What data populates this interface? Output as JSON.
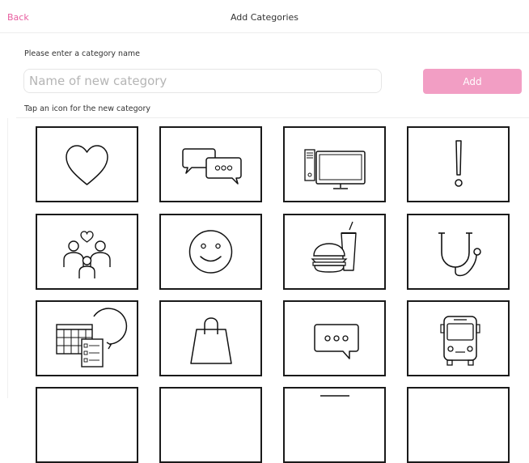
{
  "header": {
    "back_label": "Back",
    "title": "Add Categories"
  },
  "form": {
    "prompt": "Please enter a category name",
    "input_placeholder": "Name of new category",
    "input_value": "",
    "add_label": "Add",
    "accent_color": "#e85ea0",
    "button_color": "#f29ec4"
  },
  "icon_section": {
    "prompt": "Tap an icon for the new category",
    "icons": [
      "heart-icon",
      "chat-bubbles-icon",
      "computer-icon",
      "exclamation-icon",
      "family-icon",
      "smiley-face-icon",
      "fast-food-icon",
      "stethoscope-icon",
      "calendar-schedule-icon",
      "shopping-bag-icon",
      "speech-bubble-icon",
      "bus-icon"
    ]
  }
}
